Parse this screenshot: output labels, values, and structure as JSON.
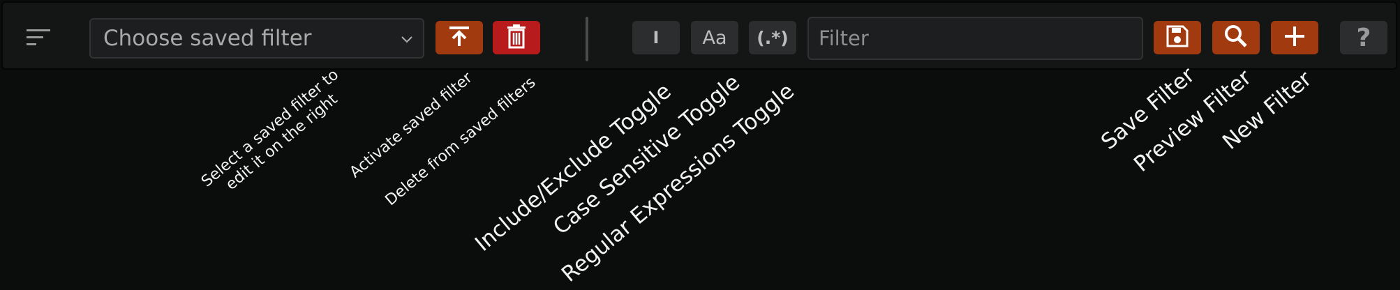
{
  "toolbar": {
    "menu_icon": "sort-lines-icon",
    "saved_filter_select": {
      "selected": "Choose saved filter"
    },
    "activate_button": {
      "icon": "upload-arrow-icon",
      "color": "#a23a10"
    },
    "delete_button": {
      "icon": "trash-icon",
      "color": "#b81b1b"
    },
    "include_exclude_toggle": {
      "glyph": "I"
    },
    "case_sensitive_toggle": {
      "glyph": "Aa"
    },
    "regex_toggle": {
      "glyph": "(.*)"
    },
    "filter_input": {
      "placeholder": "Filter",
      "value": ""
    },
    "save_button": {
      "icon": "save-disk-icon"
    },
    "preview_button": {
      "icon": "search-icon"
    },
    "new_button": {
      "icon": "plus-icon"
    },
    "help_button": {
      "glyph": "?"
    }
  },
  "annotations": {
    "select_saved": "Select a saved filter to\nedit it on the right",
    "activate_saved": "Activate saved filter",
    "delete_saved": "Delete from saved filters",
    "include_exclude": "Include/Exclude Toggle",
    "case_sensitive": "Case Sensitive Toggle",
    "regex": "Regular Expressions Toggle",
    "save_filter": "Save Filter",
    "preview_filter": "Preview Filter",
    "new_filter": "New Filter"
  },
  "colors": {
    "accent": "#a23a10",
    "danger": "#b81b1b",
    "background": "#0b0c0c"
  }
}
